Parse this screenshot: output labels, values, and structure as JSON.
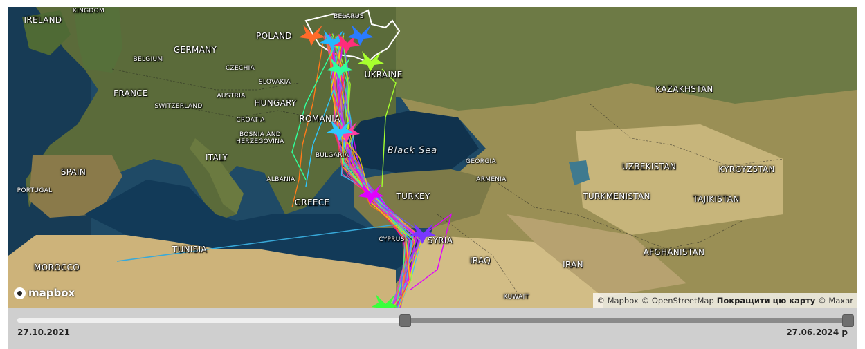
{
  "map": {
    "labels": {
      "ireland": "IRELAND",
      "kingdom": "KINGDOM",
      "belarus": "BELARUS",
      "poland": "POLAND",
      "germany": "GERMANY",
      "belgium": "BELGIUM",
      "czechia": "CZECHIA",
      "slovakia": "SLOVAKIA",
      "ukraine": "UKRAINE",
      "austria": "AUSTRIA",
      "france": "FRANCE",
      "hungary": "HUNGARY",
      "switzerland": "SWITZERLAND",
      "croatia": "CROATIA",
      "romania": "ROMANIA",
      "bosnia": "BOSNIA AND\nHERZEGOVINA",
      "italy": "ITALY",
      "spain": "SPAIN",
      "portugal": "PORTUGAL",
      "albania": "ALBANIA",
      "greece": "GREECE",
      "tunisia": "TUNISIA",
      "morocco": "MOROCCO",
      "black_sea": "Black Sea",
      "georgia": "GEORGIA",
      "armenia": "ARMENIA",
      "turkey": "TURKEY",
      "cyprus": "CYPRUS",
      "syria": "SYRIA",
      "iraq": "IRAQ",
      "iran": "IRAN",
      "kuwait": "KUWAIT",
      "kazakhstan": "KAZAKHSTAN",
      "uzbekistan": "UZBEKISTAN",
      "kyrgyzstan": "KYRGYZSTAN",
      "turkmenistan": "TURKMENISTAN",
      "tajikistan": "TAJIKISTAN",
      "afghanistan": "AFGHANISTAN",
      "bulgaria": "BULGARIA"
    },
    "logo_text": "mapbox",
    "attribution": {
      "mapbox": "© Mapbox",
      "osm": "© OpenStreetMap",
      "improve": "Покращити цю карту",
      "maxar": "© Maxar"
    },
    "track_colors": [
      "#ff3fa4",
      "#2ec7ff",
      "#a3ff2e",
      "#ff7a1a",
      "#b23cff",
      "#30ff9a",
      "#ff2d55",
      "#e100ff",
      "#6a5cff",
      "#ffd400"
    ],
    "bird_icons": [
      "bird-icon-orange",
      "bird-icon-blue",
      "bird-icon-pink",
      "bird-icon-green",
      "bird-icon-lime",
      "bird-icon-magenta",
      "bird-icon-purple"
    ]
  },
  "timeline": {
    "start_date": "27.10.2021",
    "end_date": "27.06.2024 р",
    "position": 0.46
  }
}
